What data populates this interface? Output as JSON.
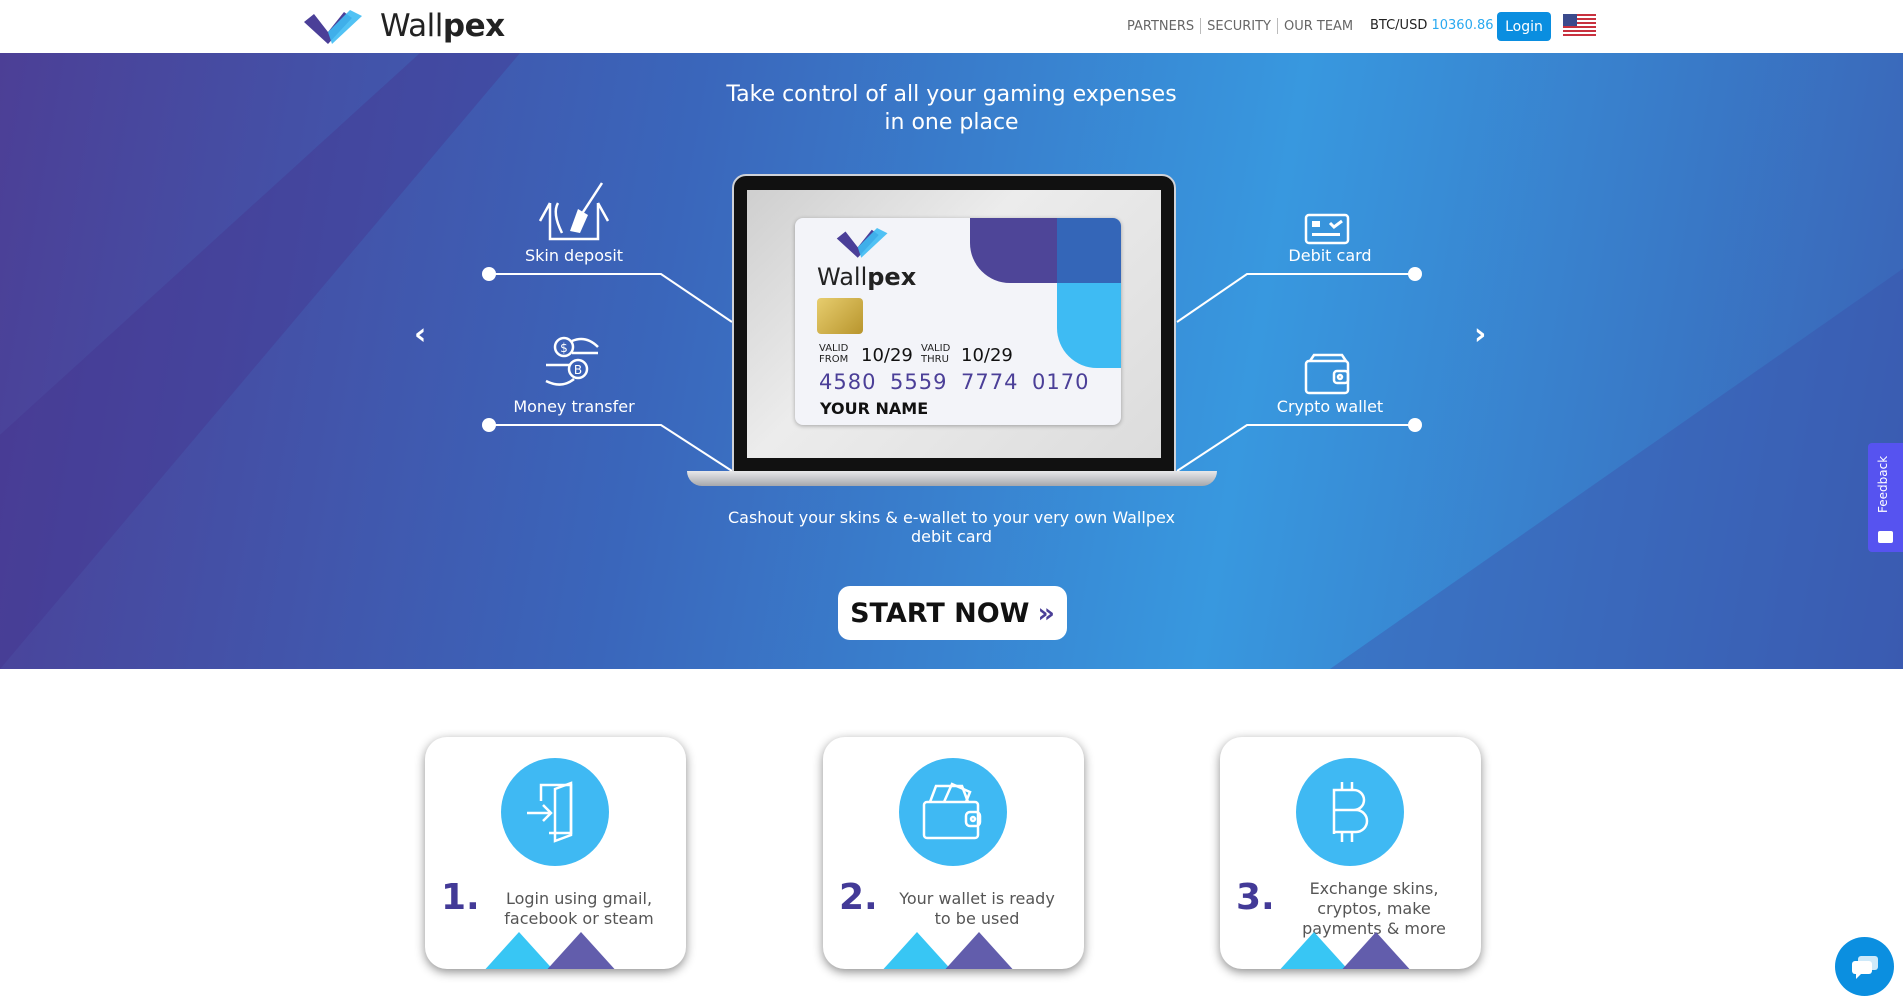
{
  "header": {
    "logo": {
      "light": "Wall",
      "bold": "pex"
    },
    "nav": [
      "PARTNERS",
      "SECURITY",
      "OUR TEAM"
    ],
    "btc_label": "BTC/USD",
    "btc_value": "10360.86",
    "login_label": "Login",
    "language_icon": "us-flag-icon"
  },
  "hero": {
    "title_line1": "Take control of all your gaming expenses",
    "title_line2": "in one place",
    "features": {
      "skin_deposit": "Skin deposit",
      "money_transfer": "Money transfer",
      "debit_card": "Debit card",
      "crypto_wallet": "Crypto wallet"
    },
    "card": {
      "brand_light": "Wall",
      "brand_bold": "pex",
      "valid_from_label1": "VALID",
      "valid_from_label2": "FROM",
      "valid_from": "10/29",
      "valid_thru_label1": "VALID",
      "valid_thru_label2": "THRU",
      "valid_thru": "10/29",
      "number": [
        "4580",
        "5559",
        "7774",
        "0170"
      ],
      "name": "YOUR NAME"
    },
    "caption_line1": "Cashout your skins & e-wallet to your very own Wallpex",
    "caption_line2": "debit card",
    "start_label": "START NOW"
  },
  "feedback_label": "Feedback",
  "steps": [
    {
      "num": "1.",
      "line1": "Login using gmail,",
      "line2": "facebook or steam"
    },
    {
      "num": "2.",
      "line1": "Your wallet is ready",
      "line2": "to be used"
    },
    {
      "num": "3.",
      "line1": "Exchange skins,",
      "line2": "cryptos, make",
      "line3": "payments & more"
    }
  ],
  "colors": {
    "primary": "#0a8ee0",
    "purple": "#433a97",
    "cyan": "#3fb9f3"
  }
}
